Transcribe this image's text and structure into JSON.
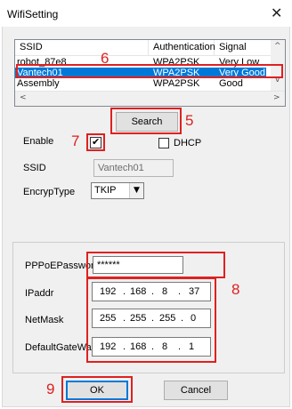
{
  "window": {
    "title": "WifiSetting",
    "close_glyph": "✕"
  },
  "list": {
    "columns": [
      "SSID",
      "Authentication",
      "Signal"
    ],
    "rows": [
      {
        "ssid": "robot_87e8",
        "auth": "WPA2PSK",
        "signal": "Very Low",
        "selected": false
      },
      {
        "ssid": "Vantech01",
        "auth": "WPA2PSK",
        "signal": "Very Good",
        "selected": true
      },
      {
        "ssid": "Assembly",
        "auth": "WPA2PSK",
        "signal": "Good",
        "selected": false
      }
    ]
  },
  "buttons": {
    "search": "Search",
    "ok": "OK",
    "cancel": "Cancel"
  },
  "form": {
    "enable_label": "Enable",
    "enable_checked": true,
    "dhcp_label": "DHCP",
    "dhcp_checked": false,
    "ssid_label": "SSID",
    "ssid_value": "Vantech01",
    "encryp_label": "EncrypType",
    "encryp_value": "TKIP"
  },
  "network": {
    "pppoe_label": "PPPoEPassword",
    "pppoe_value": "******",
    "ipaddr_label": "IPaddr",
    "ipaddr": [
      "192",
      "168",
      "8",
      "37"
    ],
    "netmask_label": "NetMask",
    "netmask": [
      "255",
      "255",
      "255",
      "0"
    ],
    "gateway_label": "DefaultGateWa",
    "gateway": [
      "192",
      "168",
      "8",
      "1"
    ]
  },
  "annotations": {
    "n5": "5",
    "n6": "6",
    "n7": "7",
    "n8": "8",
    "n9": "9"
  },
  "glyphs": {
    "check": "✔",
    "dropdown": "▼",
    "up": "^",
    "down": "v",
    "left": "<",
    "right": ">"
  },
  "colors": {
    "annotation": "#e02020",
    "selection": "#0078d7"
  }
}
